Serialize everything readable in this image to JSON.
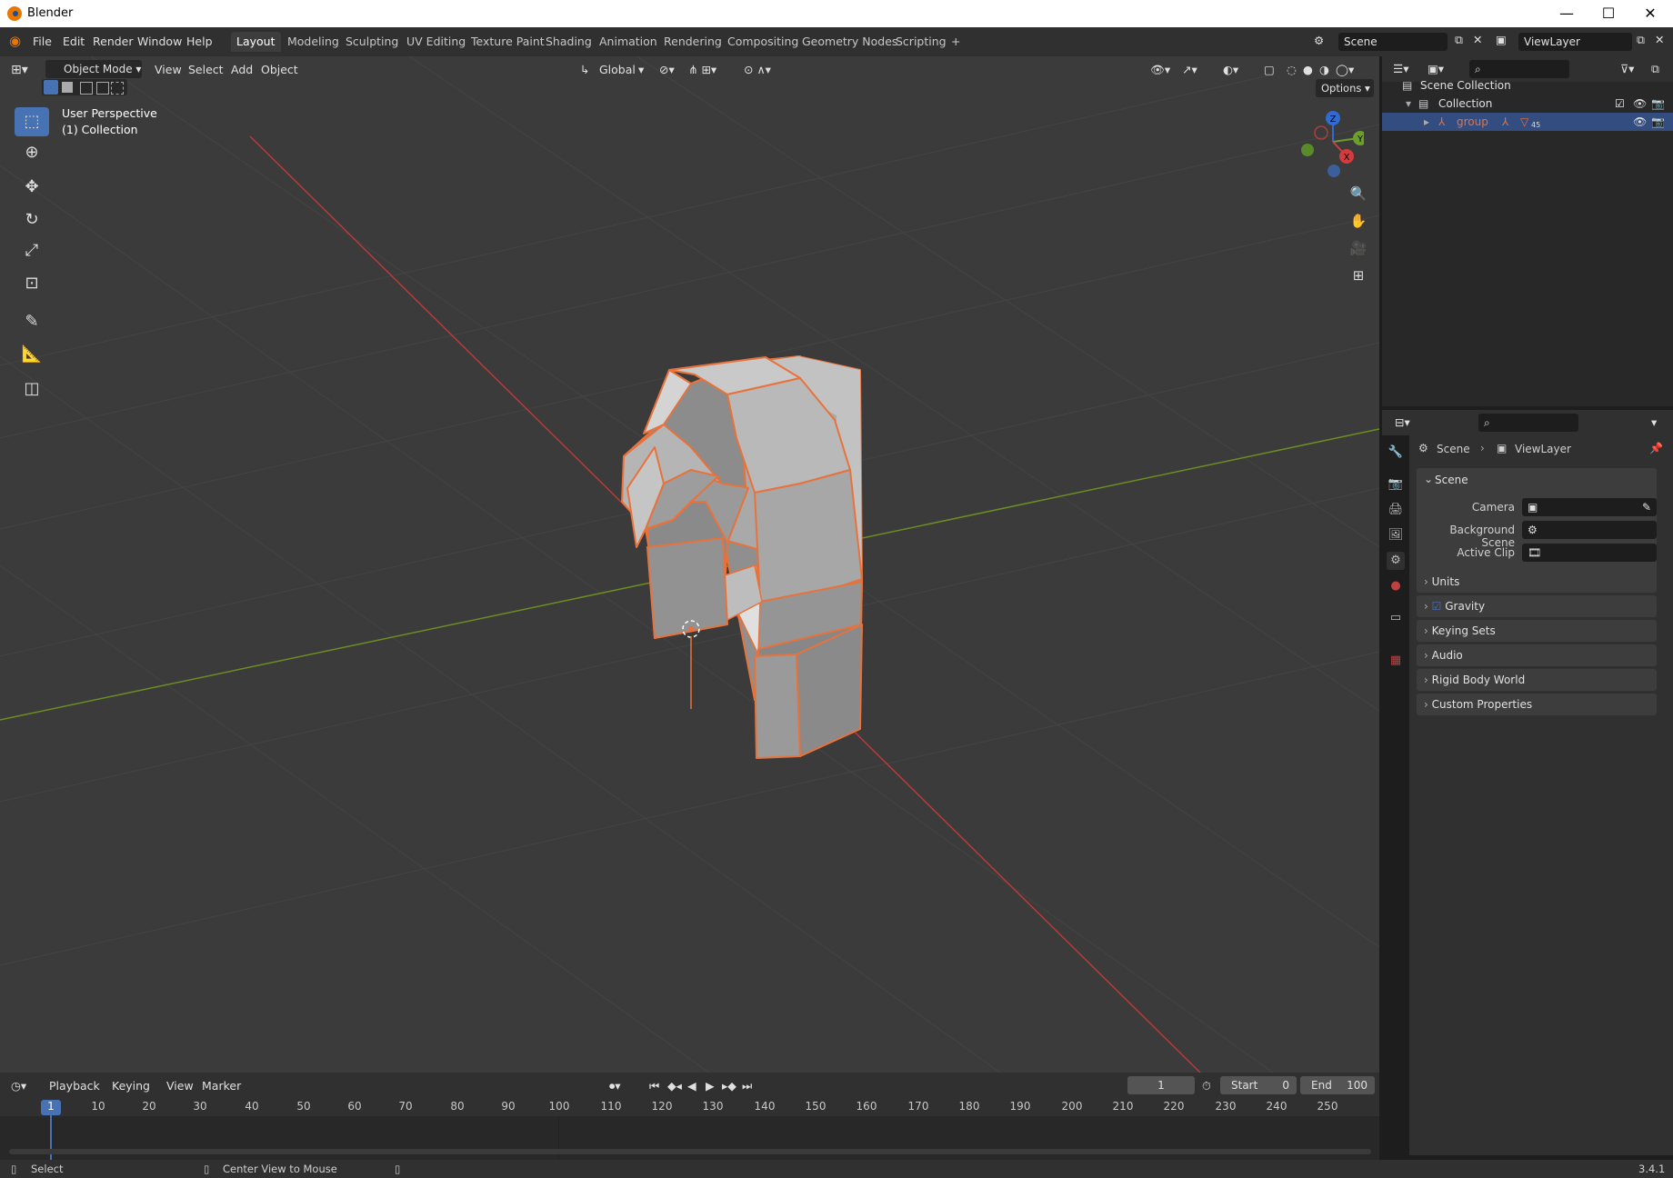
{
  "window": {
    "title": "Blender",
    "minimize": "—",
    "maximize": "☐",
    "close": "✕"
  },
  "menu": {
    "file": "File",
    "edit": "Edit",
    "render": "Render",
    "window": "Window",
    "help": "Help"
  },
  "workspaces": [
    "Layout",
    "Modeling",
    "Sculpting",
    "UV Editing",
    "Texture Paint",
    "Shading",
    "Animation",
    "Rendering",
    "Compositing",
    "Geometry Nodes",
    "Scripting",
    "+"
  ],
  "scene_selector": {
    "scene": "Scene",
    "view_layer": "ViewLayer"
  },
  "viewport_header": {
    "mode": "Object Mode",
    "view": "View",
    "select": "Select",
    "add": "Add",
    "object": "Object",
    "transform_orientation": "Global",
    "options": "Options"
  },
  "viewport_overlay": {
    "perspective": "User Perspective",
    "collection": "(1) Collection"
  },
  "gizmo": {
    "x": "X",
    "y": "Y",
    "z": "Z"
  },
  "outliner": {
    "search_placeholder": "",
    "scene_collection": "Scene Collection",
    "collection": "Collection",
    "group": "group",
    "group_count": "45"
  },
  "properties": {
    "breadcrumb_scene": "Scene",
    "breadcrumb_viewlayer": "ViewLayer",
    "panel_scene": "Scene",
    "camera_label": "Camera",
    "background_scene_label": "Background Scene",
    "active_clip_label": "Active Clip",
    "panels": [
      "Units",
      "Gravity",
      "Keying Sets",
      "Audio",
      "Rigid Body World",
      "Custom Properties"
    ]
  },
  "timeline": {
    "playback": "Playback",
    "keying": "Keying",
    "view": "View",
    "marker": "Marker",
    "current_frame": "1",
    "start_label": "Start",
    "start": "0",
    "end_label": "End",
    "end": "100",
    "ticks": [
      "1",
      "10",
      "20",
      "30",
      "40",
      "50",
      "60",
      "70",
      "80",
      "90",
      "100",
      "110",
      "120",
      "130",
      "140",
      "150",
      "160",
      "170",
      "180",
      "190",
      "200",
      "210",
      "220",
      "230",
      "240",
      "250"
    ]
  },
  "statusbar": {
    "select": "Select",
    "center_view": "Center View to Mouse",
    "version": "3.4.1"
  },
  "colors": {
    "accent": "#4772b3",
    "selection": "#e8723b",
    "x_axis": "#b83a3a",
    "y_axis": "#6b8e23"
  }
}
